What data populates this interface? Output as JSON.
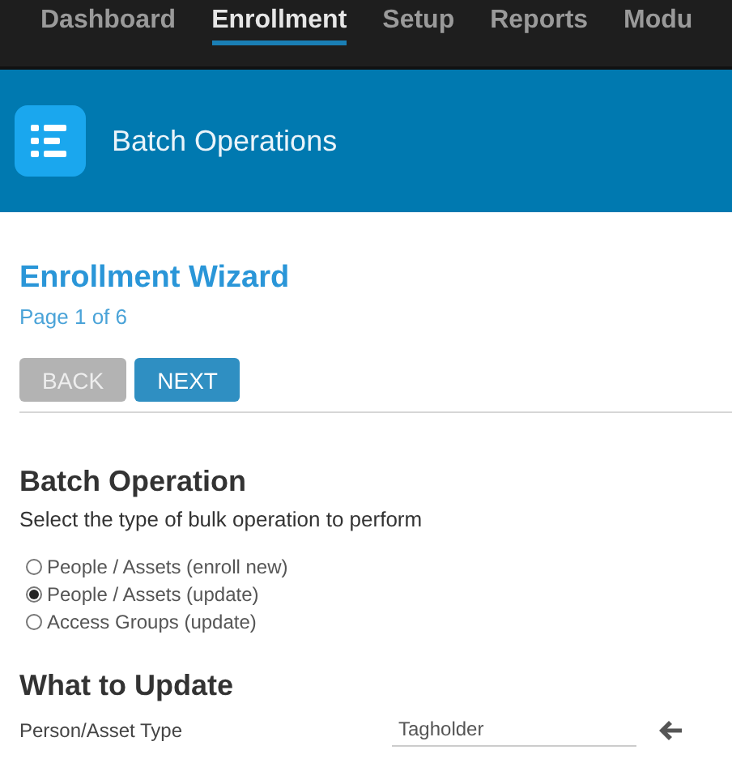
{
  "nav": [
    {
      "label": "Dashboard",
      "selected": false
    },
    {
      "label": "Enrollment",
      "selected": true
    },
    {
      "label": "Setup",
      "selected": false
    },
    {
      "label": "Reports",
      "selected": false
    },
    {
      "label": "Modu",
      "selected": false
    }
  ],
  "header": {
    "title": "Batch Operations"
  },
  "wizard": {
    "title": "Enrollment Wizard",
    "page": "Page 1 of 6"
  },
  "buttons": [
    {
      "label": "BACK",
      "disabled": true
    },
    {
      "label": "NEXT",
      "disabled": false
    }
  ],
  "batch_operation": {
    "heading": "Batch Operation",
    "description": "Select the type of bulk operation to perform",
    "options": [
      {
        "label": "People / Assets (enroll new)",
        "selected": false
      },
      {
        "label": "People / Assets (update)",
        "selected": true
      },
      {
        "label": "Access Groups (update)",
        "selected": false
      }
    ]
  },
  "what_to_update": {
    "heading": "What to Update",
    "field": {
      "label": "Person/Asset Type",
      "value": "Tagholder"
    }
  }
}
